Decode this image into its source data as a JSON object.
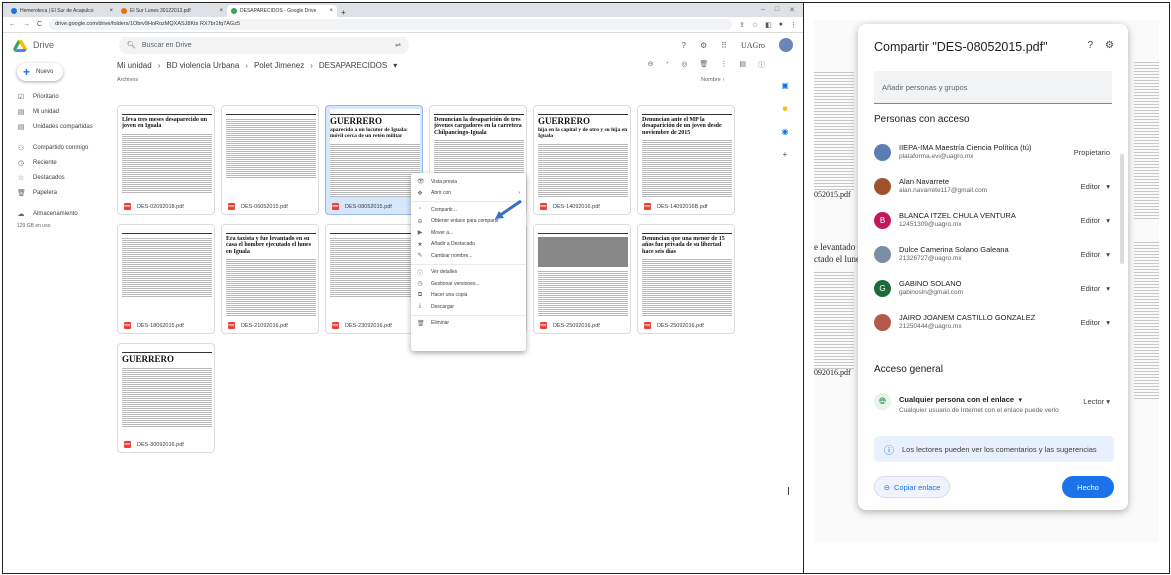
{
  "browser": {
    "tabs": [
      {
        "label": "Hemeroteca | El Sur de Acapulco",
        "color": "#1a73e8"
      },
      {
        "label": "El Sur Lunes 30122013.pdf",
        "color": "#e8710a"
      },
      {
        "label": "DESAPARECIDOS - Google Drive",
        "color": "#34a853",
        "active": true
      }
    ],
    "new_tab": "+",
    "url": "drive.google.com/drive/folders/1Obrv9HoRozMQXASJ8Kts RX7br1fq7AGz5"
  },
  "drive": {
    "app_name": "Drive",
    "search_placeholder": "Buscar en Drive",
    "org_label": "UAGro"
  },
  "sidebar": {
    "new_label": "Nuevo",
    "items": [
      {
        "label": "Prioritario",
        "icon": "☑"
      },
      {
        "label": "Mi unidad",
        "icon": "▤"
      },
      {
        "label": "Unidades compartidas",
        "icon": "▤"
      },
      {
        "label": "Compartido conmigo",
        "icon": "⚇"
      },
      {
        "label": "Reciente",
        "icon": "◷"
      },
      {
        "label": "Destacados",
        "icon": "☆"
      },
      {
        "label": "Papelera",
        "icon": "🗑"
      },
      {
        "label": "Almacenamiento",
        "icon": "☁"
      }
    ],
    "storage": "129 GB en uso"
  },
  "breadcrumb": {
    "parts": [
      "Mi unidad",
      "BD violencia Urbana",
      "Polet Jimenez",
      "DESAPARECIDOS"
    ],
    "dropdown": "▾"
  },
  "list": {
    "section": "Archivos",
    "sort": "Nombre ↑"
  },
  "files": [
    {
      "name": "DES-02092018.pdf",
      "head": "Lleva tres meses desaparecido un joven en Iguala"
    },
    {
      "name": "DES-06052015.pdf",
      "head": ""
    },
    {
      "name": "DES-08052015.pdf",
      "head": "GUERRERO",
      "sub": "aparecido a un locutor de Iguala: móvil cerca de un retén militar"
    },
    {
      "name": "DES-14082015.pdf",
      "head": "Denuncian la desaparición de tres jóvenes cargadores en la carretera Chilpancingo-Iguala"
    },
    {
      "name": "DES-14092016.pdf",
      "head": "GUERRERO",
      "sub": "hija en la capital y de otro y su hija en Iguala"
    },
    {
      "name": "DES-14092016B.pdf",
      "head": "Denuncian ante el MP la desaparición de un joven desde noviembre de 2015"
    },
    {
      "name": "DES-18062015.pdf",
      "head": ""
    },
    {
      "name": "DES-21092016.pdf",
      "head": "Era taxista y fue levantado en su casa el hombre ejecutado el lunes en Iguala"
    },
    {
      "name": "DES-23092016.pdf",
      "head": ""
    },
    {
      "name": "DES-24092016.pdf",
      "head": ""
    },
    {
      "name": "DES-25092016.pdf",
      "head": ""
    },
    {
      "name": "DES-25092016.pdf",
      "head": "Denuncian que una menor de 15 años fue privada de su libertad hace seis días"
    },
    {
      "name": "DES-30092016.pdf",
      "head": "GUERRERO"
    }
  ],
  "context_menu": [
    {
      "label": "Vista previa",
      "icon": "👁"
    },
    {
      "label": "Abrir con",
      "icon": "✥",
      "arrow": "›"
    },
    {
      "sep": true
    },
    {
      "label": "Compartir...",
      "icon": "⁺"
    },
    {
      "label": "Obtener enlace para compartir",
      "icon": "⊖"
    },
    {
      "label": "Mover a...",
      "icon": "▶"
    },
    {
      "label": "Añadir a Destacado",
      "icon": "★"
    },
    {
      "label": "Cambiar nombre...",
      "icon": "✎"
    },
    {
      "sep": true
    },
    {
      "label": "Ver detalles",
      "icon": "ⓘ"
    },
    {
      "label": "Gestionar versiones...",
      "icon": "◷"
    },
    {
      "label": "Hacer una copia",
      "icon": "⧉"
    },
    {
      "label": "Descargar",
      "icon": "⤓"
    },
    {
      "sep": true
    },
    {
      "label": "Eliminar",
      "icon": "🗑"
    }
  ],
  "share": {
    "title": "Compartir \"DES-08052015.pdf\"",
    "add_placeholder": "Añadir personas y grupos",
    "people_header": "Personas con acceso",
    "people": [
      {
        "name": "IIEPA-IMA Maestría Ciencia Política (tú)",
        "email": "plataforma.evi@uagro.mx",
        "role": "Propietario",
        "avatar": "",
        "color": "#5b7db3"
      },
      {
        "name": "Alan Navarrete",
        "email": "alan.navarrete117@gmail.com",
        "role": "Editor",
        "avatar": "",
        "color": "#a0522d"
      },
      {
        "name": "BLANCA ITZEL CHULA VENTURA",
        "email": "12451309@uagro.mx",
        "role": "Editor",
        "avatar": "B",
        "color": "#c2185b"
      },
      {
        "name": "Dulce Camerina Solano Galeana",
        "email": "21326727@uagro.mx",
        "role": "Editor",
        "avatar": "",
        "color": "#7a8fa6"
      },
      {
        "name": "GABINO SOLANO",
        "email": "gabinosln@gmail.com",
        "role": "Editor",
        "avatar": "G",
        "color": "#1e6b3a"
      },
      {
        "name": "JAIRO JOANEM CASTILLO GONZALEZ",
        "email": "21250444@uagro.mx",
        "role": "Editor",
        "avatar": "",
        "color": "#b35a4a"
      }
    ],
    "role_arrow": "▾",
    "general_header": "Acceso general",
    "general_value": "Cualquier persona con el enlace",
    "general_desc": "Cualquier usuario de Internet con el enlace puede verlo",
    "general_role": "Lector",
    "info": "Los lectores pueden ver los comentarios y las sugerencias",
    "copy_label": "Copiar enlace",
    "done_label": "Hecho"
  },
  "bg_fragments": [
    "052015.pdf",
    "092016.pdf",
    "e levantado en su",
    "ctado el lunes en"
  ],
  "colors": {
    "accent": "#1a73e8",
    "selected": "#d6e6fc"
  }
}
